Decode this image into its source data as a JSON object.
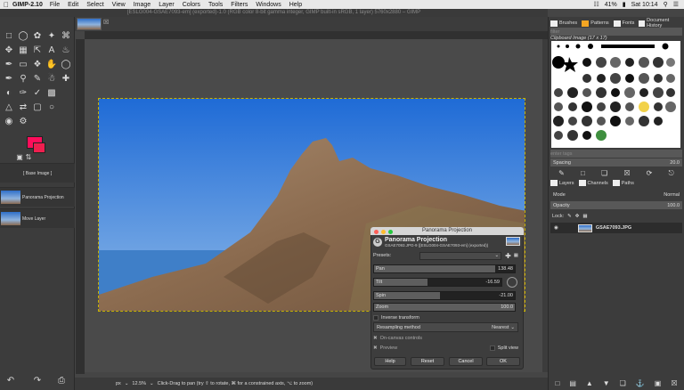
{
  "menubar": {
    "app": "GIMP-2.10",
    "items": [
      "File",
      "Edit",
      "Select",
      "View",
      "Image",
      "Layer",
      "Colors",
      "Tools",
      "Filters",
      "Windows",
      "Help"
    ],
    "battery": "41%",
    "clock": "Sat 10:14"
  },
  "window_title": "[ESLG004-GSAE7093-em] (exported)-1.0 (RGB color 8-bit gamma integer, GIMP built-in sRGB, 1 layer) 5760x2880 – GIMP",
  "colors": {
    "foreground": "#ff0d5b",
    "background": "#ef1f4f",
    "selection": "#c8b400"
  },
  "toolbox": {
    "tools": [
      "rect-select",
      "ellipse-select",
      "free-select",
      "fuzzy-select",
      "crop",
      "move",
      "align",
      "scale",
      "text",
      "bucket",
      "paintbrush",
      "eraser",
      "clone",
      "smudge",
      "measure",
      "paths",
      "zoom",
      "color-picker",
      "warp",
      "heal",
      "dodge",
      "airbrush",
      "ink",
      "gradient"
    ],
    "docked_items": [
      {
        "label": "[ Base Image ]"
      },
      {
        "label": "Panorama Projection"
      },
      {
        "label": "Move Layer"
      }
    ]
  },
  "status": {
    "unit": "px",
    "zoom": "12.5%",
    "hint": "Click-Drag to pan (try ⇧ to rotate, ⌘ for a constrained axis, ⌥ to zoom)"
  },
  "right_dock": {
    "tabs": [
      "Brushes",
      "Patterns",
      "Fonts",
      "Document History"
    ],
    "filter_placeholder": "filter",
    "brush_name": "Clipboard Image (17 x 17)",
    "tag_placeholder": "enter tags",
    "spacing_label": "Spacing",
    "spacing_value": "20.0",
    "layers_tabs": [
      "Layers",
      "Channels",
      "Paths"
    ],
    "mode_label": "Mode",
    "mode_value": "Normal",
    "opacity_label": "Opacity",
    "opacity_value": "100.0",
    "lock_label": "Lock:",
    "layer_name": "GSAE7093.JPG"
  },
  "dialog": {
    "title": "Panorama Projection",
    "heading": "Panorama Projection",
    "subheading": "GSAE7093.JPG-9 ([ESLG004-GSAE7093-em] (exported))",
    "presets_label": "Presets:",
    "pan_label": "Pan",
    "pan_value": "138.48",
    "pan_fraction": 0.86,
    "tilt_label": "Tilt",
    "tilt_value": "-16.59",
    "tilt_fraction": 0.42,
    "spin_label": "Spin",
    "spin_value": "-21.00",
    "spin_fraction": 0.47,
    "zoom_label": "Zoom",
    "zoom_value": "100.0",
    "zoom_fraction": 1.0,
    "inverse_label": "Inverse transform",
    "resampling_label": "Resampling method",
    "resampling_value": "Nearest",
    "oncanvas_label": "On-canvas controls",
    "preview_label": "Preview",
    "split_label": "Split view",
    "buttons": {
      "help": "Help",
      "reset": "Reset",
      "cancel": "Cancel",
      "ok": "OK"
    }
  }
}
